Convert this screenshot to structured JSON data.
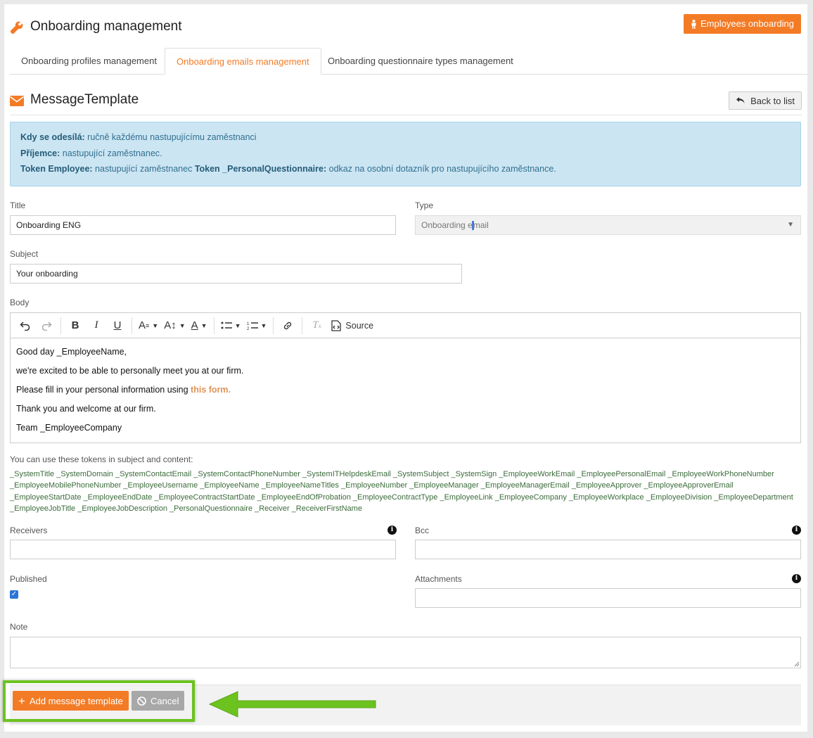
{
  "header": {
    "title": "Onboarding management",
    "onboarding_button": "Employees onboarding"
  },
  "tabs": [
    {
      "label": "Onboarding profiles management"
    },
    {
      "label": "Onboarding emails management"
    },
    {
      "label": "Onboarding questionnaire types management"
    }
  ],
  "section": {
    "title": "MessageTemplate",
    "back_label": "Back to list"
  },
  "alert": {
    "line1_label": "Kdy se odesílá:",
    "line1_text": " ručně každému nastupujícímu zaměstnanci",
    "line2_label": "Příjemce:",
    "line2_text": " nastupující zaměstnanec.",
    "line3_label_a": "Token Employee:",
    "line3_text_a": " nastupující zaměstnanec ",
    "line3_label_b": "Token _PersonalQuestionnaire:",
    "line3_text_b": " odkaz na osobní dotazník pro nastupujícího zaměstnance."
  },
  "form": {
    "title_label": "Title",
    "title_value": "Onboarding ENG",
    "type_label": "Type",
    "type_value_a": "Onboarding e",
    "type_value_b": "mail",
    "subject_label": "Subject",
    "subject_value": "Your onboarding",
    "body_label": "Body",
    "source_label": "Source",
    "body_lines": [
      "Good day _EmployeeName,",
      "we're excited to be able to personally meet you at our firm.",
      "Please fill in your personal information using ",
      "Thank you and welcome at our firm.",
      "Team _EmployeeCompany"
    ],
    "body_link": "this form.",
    "tokens_intro": "You can use these tokens in subject and content:",
    "tokens": "_SystemTitle _SystemDomain _SystemContactEmail _SystemContactPhoneNumber _SystemITHelpdeskEmail _SystemSubject _SystemSign _EmployeeWorkEmail _EmployeePersonalEmail _EmployeeWorkPhoneNumber _EmployeeMobilePhoneNumber _EmployeeUsername _EmployeeName _EmployeeNameTitles _EmployeeNumber _EmployeeManager _EmployeeManagerEmail _EmployeeApprover _EmployeeApproverEmail _EmployeeStartDate _EmployeeEndDate _EmployeeContractStartDate _EmployeeEndOfProbation _EmployeeContractType _EmployeeLink _EmployeeCompany _EmployeeWorkplace _EmployeeDivision _EmployeeDepartment _EmployeeJobTitle _EmployeeJobDescription _PersonalQuestionnaire _Receiver _ReceiverFirstName",
    "receivers_label": "Receivers",
    "bcc_label": "Bcc",
    "published_label": "Published",
    "published_checked": true,
    "attachments_label": "Attachments",
    "note_label": "Note"
  },
  "footer": {
    "add_label": "Add message template",
    "cancel_label": "Cancel"
  },
  "colors": {
    "accent": "#f47b25",
    "highlight": "#6cc31f",
    "alert_bg": "#cce5f3"
  }
}
